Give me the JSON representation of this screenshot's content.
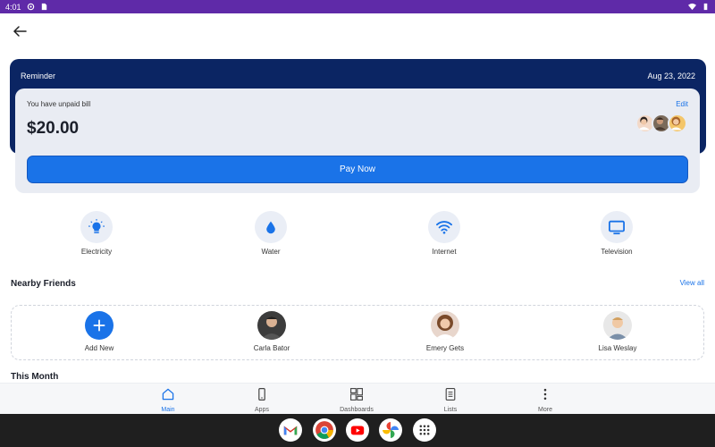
{
  "status_bar": {
    "time": "4:01"
  },
  "reminder": {
    "title": "Reminder",
    "date": "Aug 23, 2022"
  },
  "bill": {
    "message": "You have unpaid bill",
    "amount": "$20.00",
    "edit_label": "Edit",
    "pay_label": "Pay Now"
  },
  "utilities": [
    {
      "label": "Electricity",
      "icon": "lightbulb-icon"
    },
    {
      "label": "Water",
      "icon": "water-drop-icon"
    },
    {
      "label": "Internet",
      "icon": "wifi-icon"
    },
    {
      "label": "Television",
      "icon": "tv-icon"
    }
  ],
  "nearby": {
    "title": "Nearby Friends",
    "view_all": "View all",
    "friends": [
      {
        "name": "Add New"
      },
      {
        "name": "Carla Bator"
      },
      {
        "name": "Emery Gets"
      },
      {
        "name": "Lisa Weslay"
      }
    ]
  },
  "this_month": {
    "title": "This Month"
  },
  "bottom_nav": [
    {
      "label": "Main",
      "icon": "home-icon"
    },
    {
      "label": "Apps",
      "icon": "phone-icon"
    },
    {
      "label": "Dashboards",
      "icon": "dashboard-icon"
    },
    {
      "label": "Lists",
      "icon": "list-icon"
    },
    {
      "label": "More",
      "icon": "more-vertical-icon"
    }
  ],
  "taskbar_apps": [
    "gmail-icon",
    "chrome-icon",
    "youtube-icon",
    "photos-icon",
    "app-drawer-icon"
  ],
  "colors": {
    "accent": "#1a73e8",
    "header": "#0b2563",
    "status_bar": "#5f2aa8"
  }
}
